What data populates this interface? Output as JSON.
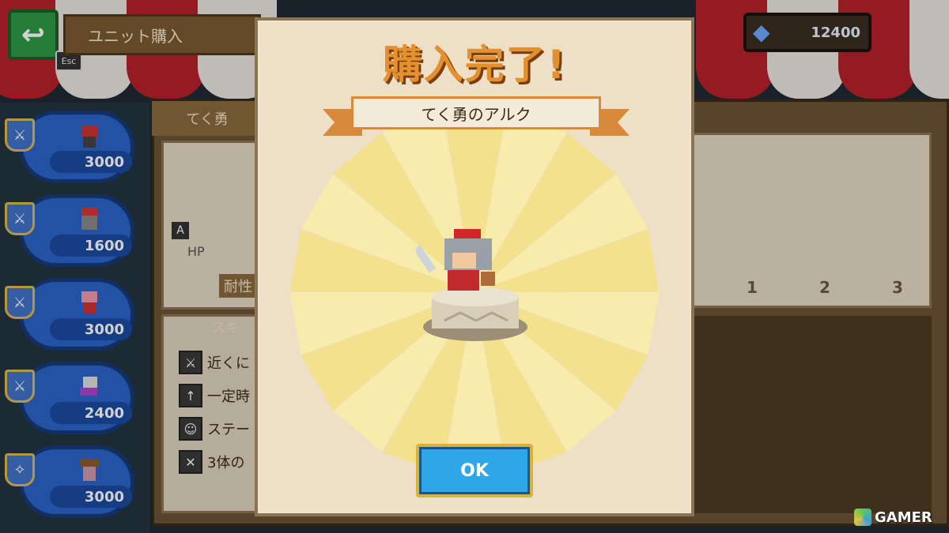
{
  "header": {
    "back_icon": "back-arrow-icon",
    "esc_label": "Esc",
    "title": "ユニット購入",
    "gem_icon": "diamond-icon",
    "gem_count": "12400"
  },
  "unit_list": [
    {
      "price": "3000"
    },
    {
      "price": "1600"
    },
    {
      "price": "3000"
    },
    {
      "price": "2400"
    },
    {
      "price": "3000"
    }
  ],
  "detail": {
    "name_partial": "てく勇",
    "hp_label": "HP",
    "resist_label": "耐性",
    "skill_header": "スキ",
    "skills": [
      "近くに",
      "一定時",
      "ステー",
      "3体の"
    ],
    "axis_ticks": [
      "1",
      "2",
      "3"
    ],
    "a_badge": "A"
  },
  "modal": {
    "title": "購入完了!",
    "unit_name": "てく勇のアルク",
    "ok_label": "OK"
  },
  "watermark": {
    "text": "GAMER"
  },
  "colors": {
    "awning_red": "#b8202a",
    "awning_white": "#e9e4df",
    "title_orange": "#e3912e",
    "ok_blue": "#2fa6e8",
    "gold_border": "#d9b23a"
  }
}
